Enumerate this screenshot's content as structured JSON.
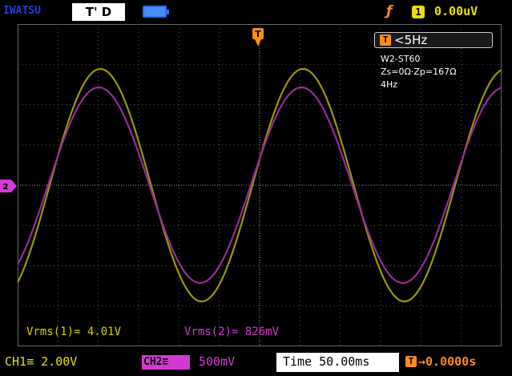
{
  "header": {
    "brand": "IWATSU",
    "trigger_state": "T' D",
    "trigger_source": "1",
    "trigger_level": "0.00uV"
  },
  "measurements": {
    "frequency_label": "T",
    "frequency": "<5Hz",
    "notes": [
      "W2-ST60",
      "Zs=0Ω·Zp=167Ω",
      "4Hz"
    ],
    "vrms1": "Vrms(1)= 4.01V",
    "vrms2": "Vrms(2)= 826mV"
  },
  "footer": {
    "ch1": "CH1≡ 2.00V",
    "ch2_label": "CH2≡",
    "ch2_scale": "500mV",
    "timebase": "Time 50.00ms",
    "hpos_label": "T",
    "hpos": "→0.0000s"
  },
  "markers": {
    "trigger_marker": "T",
    "ground_marker": "2"
  },
  "colors": {
    "ch1": "#d6d000",
    "ch2": "#d23ad2",
    "trigger": "#ff8c1a"
  },
  "icons": [
    "battery-icon",
    "rising-edge-icon"
  ]
}
